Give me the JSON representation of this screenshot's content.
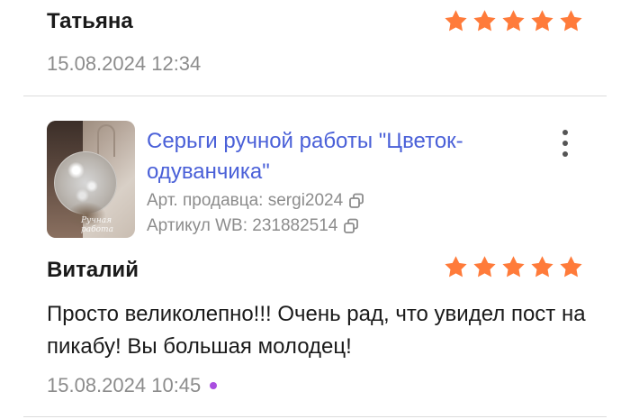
{
  "reviews": [
    {
      "author": "Татьяна",
      "rating": 5,
      "date": "15.08.2024 12:34"
    },
    {
      "author": "Виталий",
      "rating": 5,
      "text": "Просто великолепно!!! Очень рад, что увидел пост на пикабу! Вы большая молодец!",
      "date": "15.08.2024 10:45",
      "unread_dot": true
    }
  ],
  "product": {
    "title": "Серьги ручной работы \"Цветок-одуванчика\"",
    "seller_article": "Арт. продавца: sergi2024",
    "wb_article": "Артикул WB: 231882514",
    "image_watermark": "Ручная работа",
    "image_icon": "earring-photo"
  },
  "colors": {
    "star": "#ff7b3a",
    "link": "#4a60d8",
    "muted": "#8c8c8c",
    "dot": "#a94ee0"
  },
  "icons": {
    "star": "star-icon",
    "copy": "copy-icon",
    "more": "more-vertical-icon"
  }
}
